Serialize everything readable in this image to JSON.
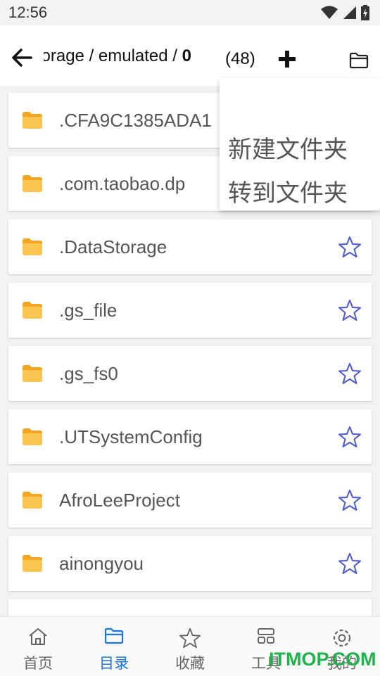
{
  "status": {
    "time": "12:56"
  },
  "appbar": {
    "path_prefix": "storage / emulated / ",
    "path_current": "0",
    "count": "(48)"
  },
  "folders": [
    {
      "name": ".CFA9C1385ADA1"
    },
    {
      "name": ".com.taobao.dp"
    },
    {
      "name": ".DataStorage"
    },
    {
      "name": ".gs_file"
    },
    {
      "name": ".gs_fs0"
    },
    {
      "name": ".UTSystemConfig"
    },
    {
      "name": "AfroLeeProject"
    },
    {
      "name": "ainongyou"
    },
    {
      "name": ""
    }
  ],
  "menu": {
    "new_folder": "新建文件夹",
    "goto_folder": "转到文件夹"
  },
  "nav": [
    {
      "label": "首页",
      "icon": "home-icon",
      "active": false
    },
    {
      "label": "目录",
      "icon": "folder-icon",
      "active": true
    },
    {
      "label": "收藏",
      "icon": "star-icon",
      "active": false
    },
    {
      "label": "工具",
      "icon": "tools-icon",
      "active": false
    },
    {
      "label": "我的",
      "icon": "gear-icon",
      "active": false
    }
  ],
  "watermark": "ITMOP.COM",
  "colors": {
    "accent": "#1a73e8",
    "folder": "#f8b830",
    "star": "#4a58d8",
    "watermark": "#21b24b"
  }
}
